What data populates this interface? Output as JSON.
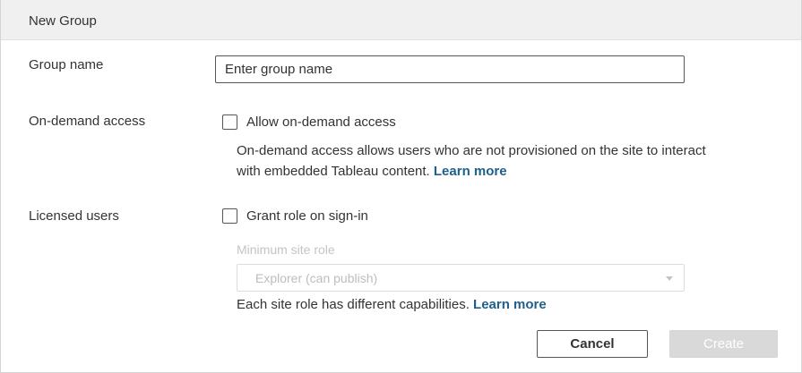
{
  "dialog": {
    "title": "New Group"
  },
  "group_name": {
    "label": "Group name",
    "placeholder": "Enter group name",
    "value": ""
  },
  "on_demand": {
    "label": "On-demand access",
    "checkbox_label": "Allow on-demand access",
    "checked": false,
    "description_line1": "On-demand access allows users who are not provisioned on the site to interact",
    "description_line2": "with embedded Tableau content.",
    "learn_more": "Learn more"
  },
  "licensed_users": {
    "label": "Licensed users",
    "checkbox_label": "Grant role on sign-in",
    "checked": false,
    "min_role_label": "Minimum site role",
    "min_role_value": "Explorer (can publish)",
    "description": "Each site role has different capabilities.",
    "learn_more": "Learn more"
  },
  "buttons": {
    "cancel": "Cancel",
    "create": "Create"
  },
  "colors": {
    "link": "#1f5f8b",
    "header_bg": "#f0f0f0",
    "disabled_button_bg": "#d9d9d9"
  },
  "icons": {
    "select_caret": "chevron-down-icon"
  }
}
